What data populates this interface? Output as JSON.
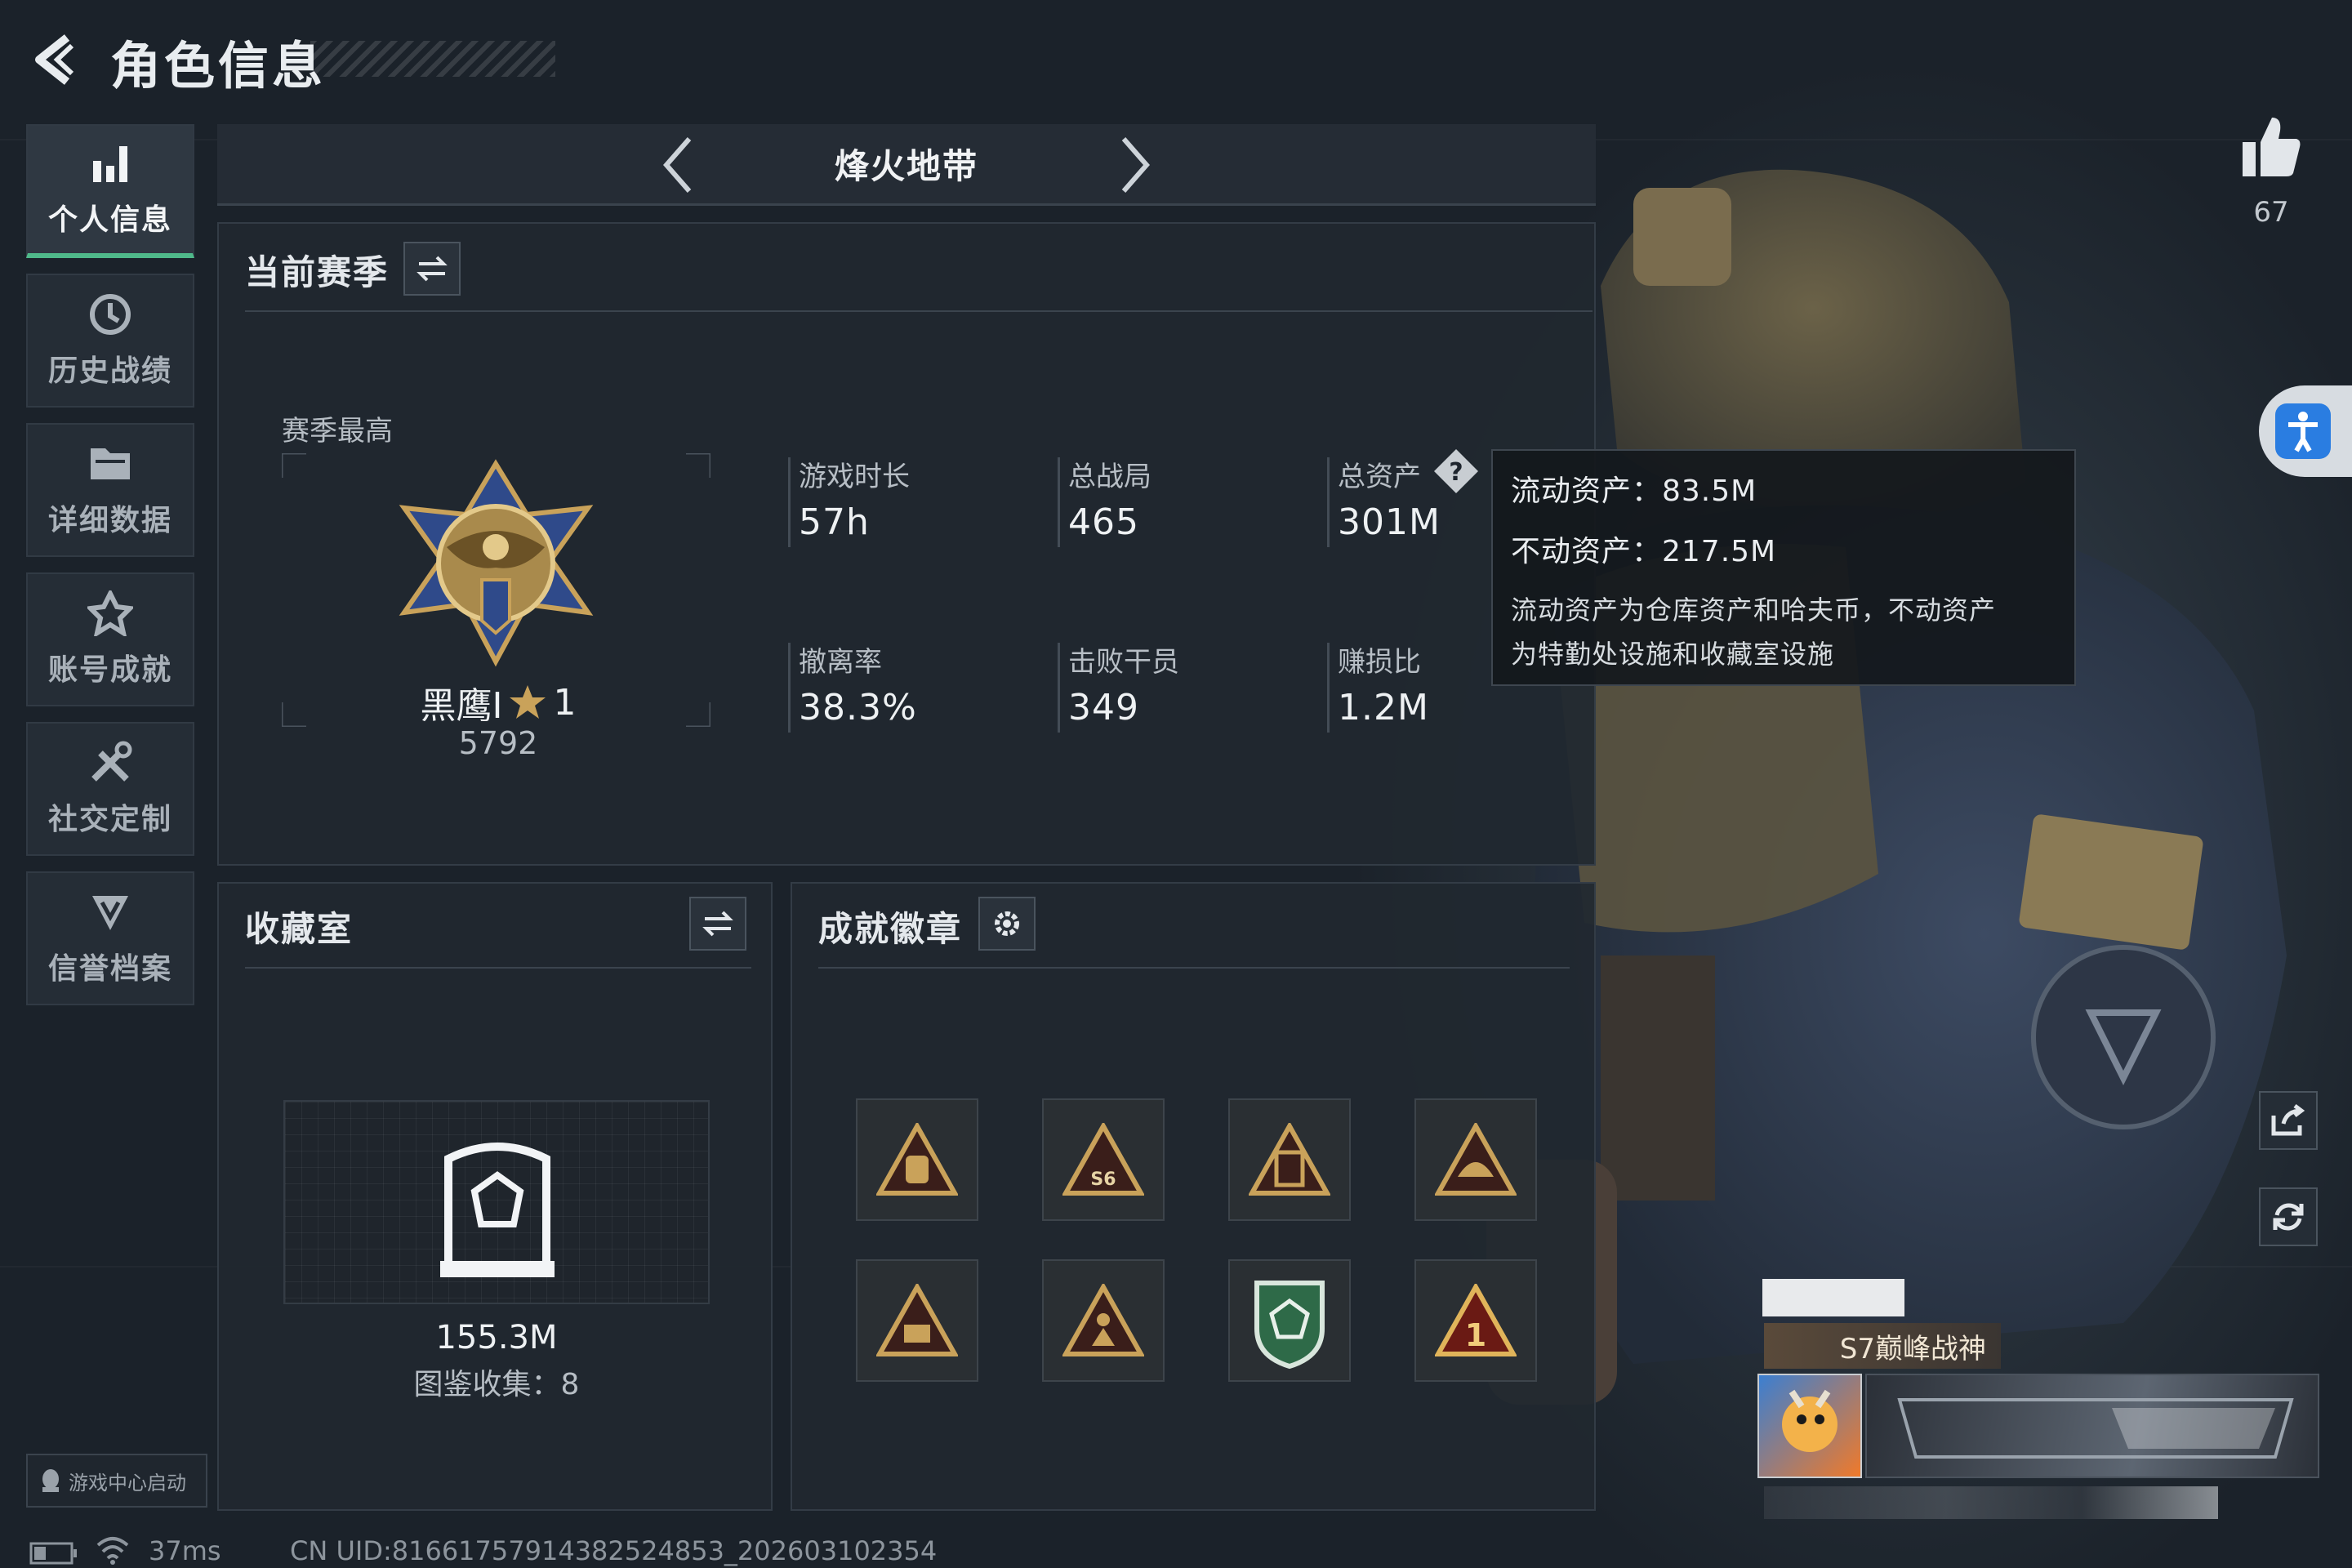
{
  "header": {
    "title": "角色信息"
  },
  "sidebar": {
    "items": [
      {
        "label": "个人信息",
        "icon": "bar-chart-icon",
        "active": true
      },
      {
        "label": "历史战绩",
        "icon": "history-clock-icon",
        "active": false
      },
      {
        "label": "详细数据",
        "icon": "folder-icon",
        "active": false
      },
      {
        "label": "账号成就",
        "icon": "achievement-icon",
        "active": false
      },
      {
        "label": "社交定制",
        "icon": "tools-icon",
        "active": false
      },
      {
        "label": "信誉档案",
        "icon": "shield-v-icon",
        "active": false
      }
    ],
    "game_center": "游戏中心启动"
  },
  "map_selector": {
    "name": "烽火地带"
  },
  "season": {
    "title": "当前赛季",
    "best_label": "赛季最高",
    "rank_name": "黑鹰I",
    "rank_stars": "1",
    "rank_points": "5792",
    "stats": [
      {
        "label": "游戏时长",
        "value": "57h"
      },
      {
        "label": "总战局",
        "value": "465"
      },
      {
        "label": "总资产",
        "value": "301M"
      },
      {
        "label": "撤离率",
        "value": "38.3%"
      },
      {
        "label": "击败干员",
        "value": "349"
      },
      {
        "label": "赚损比",
        "value": "1.2M"
      }
    ]
  },
  "tooltip": {
    "liquid": "流动资产：83.5M",
    "fixed": "不动资产：217.5M",
    "desc1": "流动资产为仓库资产和哈夫币，不动资产",
    "desc2": "为特勤处设施和收藏室设施"
  },
  "collection": {
    "title": "收藏室",
    "value": "155.3M",
    "count": "图鉴收集：8"
  },
  "achievements": {
    "title": "成就徽章"
  },
  "likes": {
    "count": "67"
  },
  "profile": {
    "season_title": "S7巅峰战神"
  },
  "status_bar": {
    "ping": "37ms",
    "uid": "CN UID:8166175791438252485​3_202603102354"
  },
  "colors": {
    "accent_green": "#4fb98a",
    "gold": "#c9a25a",
    "accessibility_blue": "#2a7de1"
  }
}
